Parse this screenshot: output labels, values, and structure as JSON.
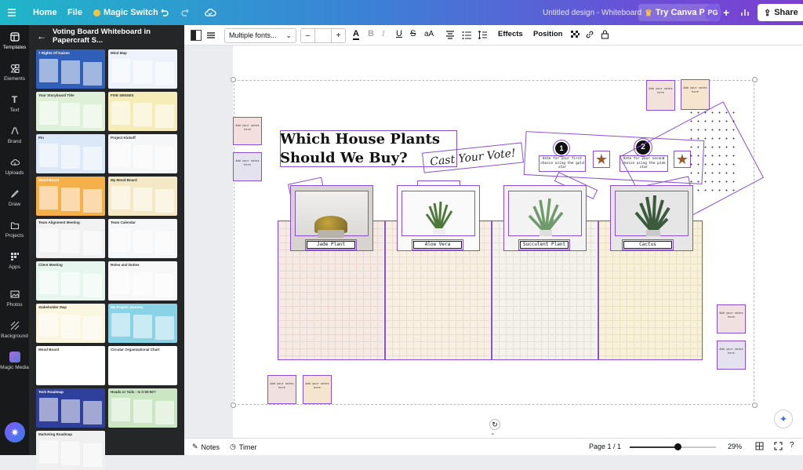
{
  "topbar": {
    "home": "Home",
    "file": "File",
    "magic_switch": "Magic Switch",
    "doc_title": "Untitled design - Whiteboard",
    "try_pro": "Try Canva Pro",
    "avatar": "PG",
    "share": "Share"
  },
  "rail": [
    {
      "label": "Templates",
      "icon": "templates-icon"
    },
    {
      "label": "Elements",
      "icon": "elements-icon"
    },
    {
      "label": "Text",
      "icon": "text-icon"
    },
    {
      "label": "Brand",
      "icon": "brand-icon"
    },
    {
      "label": "Uploads",
      "icon": "uploads-icon"
    },
    {
      "label": "Draw",
      "icon": "draw-icon"
    },
    {
      "label": "Projects",
      "icon": "projects-icon"
    },
    {
      "label": "Apps",
      "icon": "apps-icon"
    },
    {
      "label": "Photos",
      "icon": "photos-icon"
    },
    {
      "label": "Background",
      "icon": "background-icon"
    },
    {
      "label": "Magic Media",
      "icon": "magic-media-icon"
    }
  ],
  "panel": {
    "title": "Voting Board Whiteboard in Papercraft S...",
    "thumbs": [
      {
        "title": "7 Rights Of Kaizen",
        "bg": "#2f5fb8"
      },
      {
        "title": "Mind Map",
        "bg": "#eef3fb"
      },
      {
        "title": "Your Storyboard Title",
        "bg": "#dff0d8"
      },
      {
        "title": "FIVE SENSES",
        "bg": "#f5ecb8"
      },
      {
        "title": "Pin",
        "bg": "#dbe8f7"
      },
      {
        "title": "Project Kickoff",
        "bg": "#f5f6f8"
      },
      {
        "title": "Mood Board",
        "bg": "#f6b04a"
      },
      {
        "title": "My Mood Board",
        "bg": "#f4e8c5"
      },
      {
        "title": "Team Alignment Meeting",
        "bg": "#f2f2f2"
      },
      {
        "title": "Team Calendar",
        "bg": "#f6f7f9"
      },
      {
        "title": "Client Meeting",
        "bg": "#e7f6ef"
      },
      {
        "title": "Roles and Duties",
        "bg": "#f8f8f8"
      },
      {
        "title": "Stakeholder Map",
        "bg": "#fbf6df"
      },
      {
        "title": "My Project Journey",
        "bg": "#8ad3e6"
      },
      {
        "title": "Mood Board",
        "bg": "#ffffff"
      },
      {
        "title": "Circular Organizational Chart",
        "bg": "#ffffff"
      },
      {
        "title": "Tech Roadmap",
        "bg": "#2f3f9c"
      },
      {
        "title": "Heads or Tails - Is it 50-50?",
        "bg": "#cbe6c3"
      },
      {
        "title": "Marketing Roadmap",
        "bg": "#f0f0f0"
      }
    ]
  },
  "toolbar": {
    "font": "Multiple fonts...",
    "font_size": "",
    "minus": "–",
    "plus": "+",
    "effects": "Effects",
    "position": "Position"
  },
  "canvas": {
    "title_line1": "Which House Plants",
    "title_line2": "Should We Buy?",
    "cast": "Cast Your Vote!",
    "vote1_num": "1",
    "vote1_text": "Vote for your first choice using the gold star",
    "vote2_num": "2",
    "vote2_text": "Vote for your second choice using the pink star",
    "sticky_text": "Add your notes here",
    "plants": [
      "Jade Plant",
      "Aloe Vera",
      "Succulent Plant",
      "Cactus"
    ]
  },
  "status": {
    "notes": "Notes",
    "timer": "Timer",
    "page": "Page 1 / 1",
    "zoom": "29%",
    "zoom_level": 0.55
  }
}
